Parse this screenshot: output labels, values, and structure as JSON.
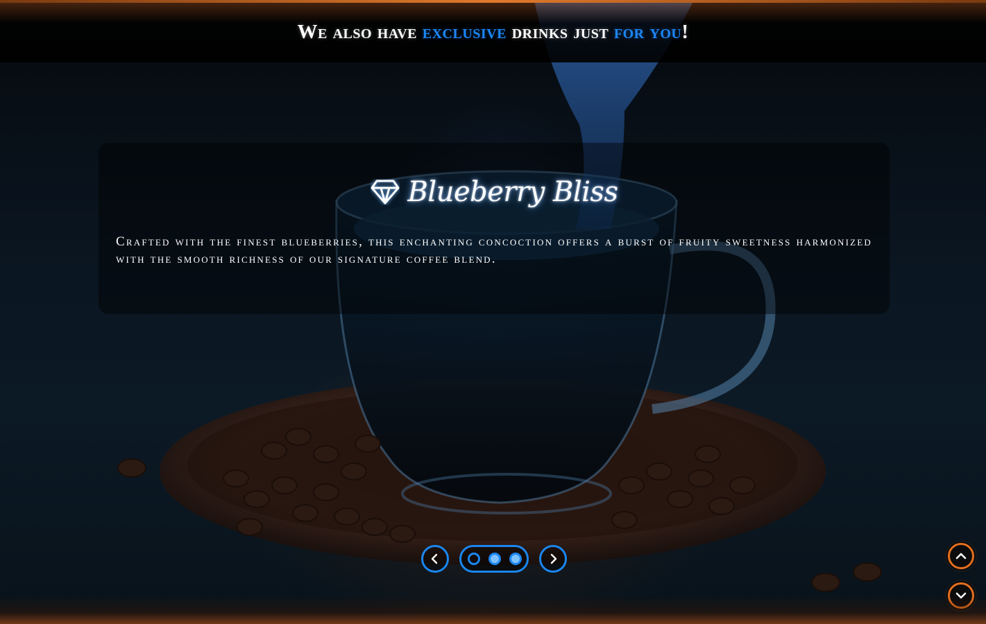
{
  "header": {
    "headline_part1": "We also have ",
    "headline_accent1": "exclusive",
    "headline_part2": " drinks just ",
    "headline_accent2": "for you",
    "headline_part3": "!"
  },
  "slide": {
    "title": "Blueberry Bliss",
    "title_icon": "diamond-icon",
    "description": "Crafted with the finest blueberries, this enchanting concoction offers a burst of fruity sweetness harmonized with the smooth richness of our signature coffee blend."
  },
  "carousel": {
    "prev_icon": "chevron-left-icon",
    "next_icon": "chevron-right-icon",
    "slide_count": 3,
    "active_index": 0
  },
  "scroll_controls": {
    "up_icon": "chevron-up-icon",
    "down_icon": "chevron-down-icon"
  },
  "colors": {
    "accent_blue": "#1c86f5",
    "accent_orange": "#e56f1f",
    "text": "#ffffff"
  }
}
